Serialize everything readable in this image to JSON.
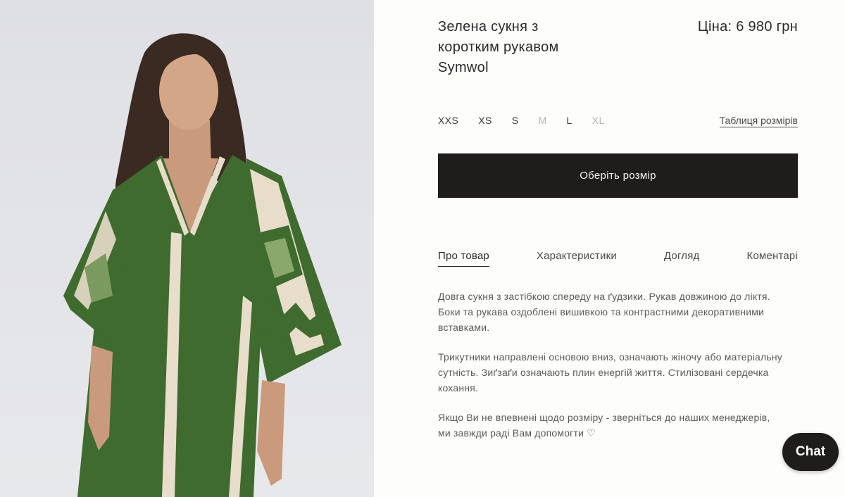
{
  "product": {
    "title": "Зелена сукня з коротким рукавом Symwol",
    "price": "Ціна: 6 980 грн",
    "image_alt": "Зелена сукня з коротким рукавом Symwol"
  },
  "sizes": [
    {
      "label": "XXS",
      "available": true
    },
    {
      "label": "XS",
      "available": true
    },
    {
      "label": "S",
      "available": true
    },
    {
      "label": "M",
      "available": false
    },
    {
      "label": "L",
      "available": true
    },
    {
      "label": "XL",
      "available": false
    }
  ],
  "size_table_label": "Таблиця розмірів",
  "cta_label": "Оберіть розмір",
  "tabs": [
    {
      "label": "Про товар",
      "active": true
    },
    {
      "label": "Характеристики",
      "active": false
    },
    {
      "label": "Догляд",
      "active": false
    },
    {
      "label": "Коментарі",
      "active": false
    }
  ],
  "description": [
    "Довга сукня з застібкою спереду на ґудзики. Рукав довжиною до ліктя. Боки та рукава оздоблені вишивкою та контрастними декоративними вставками.",
    "Трикутники направлені основою вниз, означають жіночу або матеріальну сутність. Зиґзаґи означають плин енергій життя. Стилізовані сердечка кохання.",
    "Якщо Ви не впевнені щодо розміру - зверніться до наших менеджерів, ми завжди раді Вам допомогти ♡"
  ],
  "chat_label": "Chat",
  "colors": {
    "dress_green": "#3f6b2e",
    "trim_beige": "#e8ddcb",
    "button_dark": "#1f1d1b",
    "background": "#fdfdfb"
  }
}
